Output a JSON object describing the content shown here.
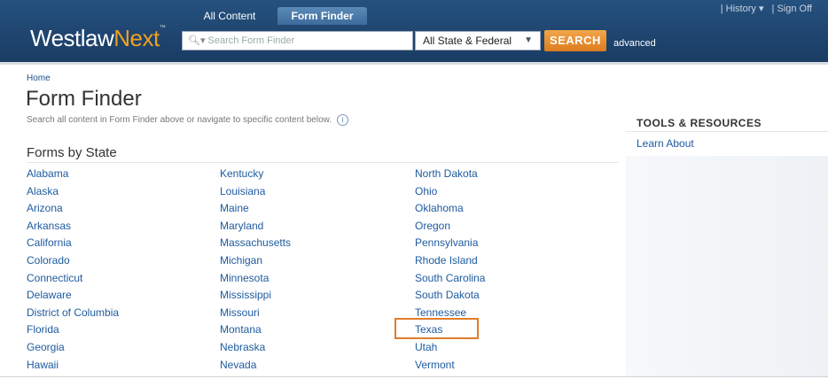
{
  "header": {
    "logo_main": "Westlaw",
    "logo_accent": "Next",
    "logo_tm": "™",
    "tabs": [
      {
        "label": "All Content"
      },
      {
        "label": "Form Finder"
      }
    ],
    "top_links": [
      "| History ▾",
      "| Sign Off"
    ],
    "search_placeholder": "Search Form Finder",
    "jurisdiction": "All State & Federal",
    "search_label": "SEARCH",
    "advanced_label": "advanced"
  },
  "main": {
    "breadcrumb": "Home",
    "title": "Form Finder",
    "subtitle": "Search all content in Form Finder above or navigate to specific content below.",
    "section_title": "Forms by State",
    "columns": [
      [
        "Alabama",
        "Alaska",
        "Arizona",
        "Arkansas",
        "California",
        "Colorado",
        "Connecticut",
        "Delaware",
        "District of Columbia",
        "Florida",
        "Georgia",
        "Hawaii"
      ],
      [
        "Kentucky",
        "Louisiana",
        "Maine",
        "Maryland",
        "Massachusetts",
        "Michigan",
        "Minnesota",
        "Mississippi",
        "Missouri",
        "Montana",
        "Nebraska",
        "Nevada"
      ],
      [
        "North Dakota",
        "Ohio",
        "Oklahoma",
        "Oregon",
        "Pennsylvania",
        "Rhode Island",
        "South Carolina",
        "South Dakota",
        "Tennessee",
        "Texas",
        "Utah",
        "Vermont"
      ]
    ]
  },
  "sidebar": {
    "title": "TOOLS & RESOURCES",
    "learn_about": "Learn About"
  },
  "colors": {
    "header": "#1e4570",
    "accent": "#f0a020",
    "link": "#1e5ba0",
    "highlight": "#e07d2a"
  }
}
